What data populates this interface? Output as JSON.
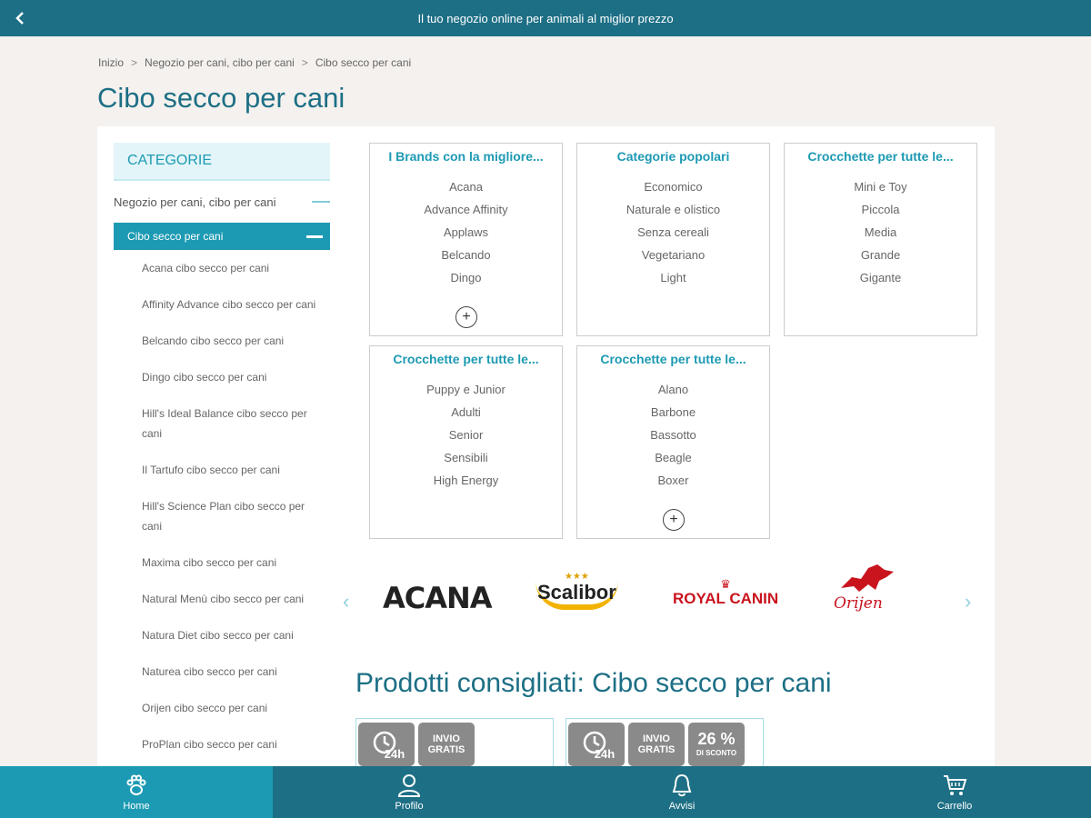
{
  "topbar": {
    "message": "Il tuo negozio online per animali al miglior prezzo"
  },
  "breadcrumb": [
    "Inizio",
    "Negozio per cani, cibo per cani",
    "Cibo secco per cani"
  ],
  "page_title": "Cibo secco per cani",
  "sidebar": {
    "header": "CATEGORIE",
    "parent": "Negozio per cani, cibo per cani",
    "active": "Cibo secco per cani",
    "items": [
      "Acana cibo secco per cani",
      "Affinity Advance cibo secco per cani",
      "Belcando cibo secco per cani",
      "Dingo cibo secco per cani",
      "Hill's Ideal Balance cibo secco per cani",
      "Il Tartufo cibo secco per cani",
      "Hill's Science Plan cibo secco per cani",
      "Maxima cibo secco per cani",
      "Natural Menù cibo secco per cani",
      "Natura Diet cibo secco per cani",
      "Naturea cibo secco per cani",
      "Orijen cibo secco per cani",
      "ProPlan cibo secco per cani"
    ]
  },
  "filters": [
    {
      "title": "I Brands con la migliore...",
      "items": [
        "Acana",
        "Advance Affinity",
        "Applaws",
        "Belcando",
        "Dingo"
      ],
      "more": true
    },
    {
      "title": "Categorie popolari",
      "items": [
        "Economico",
        "Naturale e olistico",
        "Senza cereali",
        "Vegetariano",
        "Light"
      ],
      "more": false
    },
    {
      "title": "Crocchette per tutte le...",
      "items": [
        "Mini e Toy",
        "Piccola",
        "Media",
        "Grande",
        "Gigante"
      ],
      "more": false
    },
    {
      "title": "Crocchette per tutte le...",
      "items": [
        "Puppy e Junior",
        "Adulti",
        "Senior",
        "Sensibili",
        "High Energy"
      ],
      "more": false
    },
    {
      "title": "Crocchette per tutte le...",
      "items": [
        "Alano",
        "Barbone",
        "Bassotto",
        "Beagle",
        "Boxer"
      ],
      "more": true
    }
  ],
  "brands": [
    "ACANA",
    "Scalibor",
    "ROYAL CANIN",
    "Orijen"
  ],
  "recommended_title": "Prodotti consigliati: Cibo secco per cani",
  "badges": {
    "hours": "24h",
    "shipping_line1": "INVIO",
    "shipping_line2": "GRATIS",
    "discount": "26 %",
    "discount_label": "DI SCONTO"
  },
  "bottom_nav": [
    "Home",
    "Profilo",
    "Avvisi",
    "Carrello"
  ],
  "colors": {
    "primary": "#1d6f85",
    "accent": "#1d9ab3",
    "light_accent": "#e3f5f8",
    "badge": "#8a8a8a"
  }
}
